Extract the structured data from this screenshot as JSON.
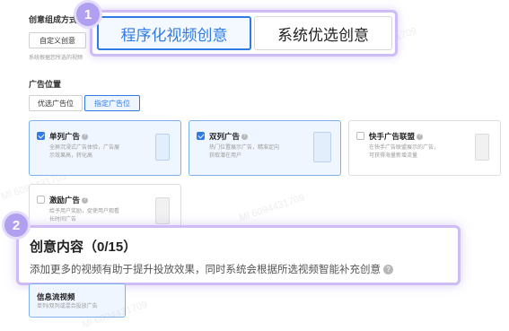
{
  "top": {
    "section_label": "创意组成方式",
    "custom_button": "自定义创意",
    "hint_text": "系统根据您所选的视频"
  },
  "callout1": {
    "badge": "1",
    "tabs": [
      {
        "label": "程序化视频创意",
        "selected": true
      },
      {
        "label": "系统优选创意",
        "selected": false
      }
    ]
  },
  "placement": {
    "label": "广告位置",
    "options": [
      {
        "label": "优选广告位",
        "selected": false
      },
      {
        "label": "指定广告位",
        "selected": true
      }
    ],
    "cards": [
      {
        "title": "单列广告",
        "desc1": "全屏沉浸式广告体验，广告展",
        "desc2": "示效果高，转化高",
        "checked": true
      },
      {
        "title": "双列广告",
        "desc1": "热门位置展示广告，精准定向",
        "desc2": "获取潜在用户",
        "checked": true
      },
      {
        "title": "快手广告联盟",
        "desc1": "在快手广告联盟展示的广告，",
        "desc2": "可获得海量新增流量",
        "checked": false
      },
      {
        "title": "激励广告",
        "desc1": "给予用户奖励，促使用户观看",
        "desc2": "长时间广告",
        "checked": false
      }
    ]
  },
  "callout2": {
    "badge": "2",
    "title": "创意内容（0/15）",
    "desc": "添加更多的视频有助于提升投放效果，同时系统会根据所选视频智能补充创意"
  },
  "format_card": {
    "title": "信息流视频",
    "desc": "单列/双列或混合投放广告"
  },
  "colors": {
    "accent": "#2f7be6",
    "callout_border": "#cdbcf5",
    "badge": "#b19ff0"
  }
}
